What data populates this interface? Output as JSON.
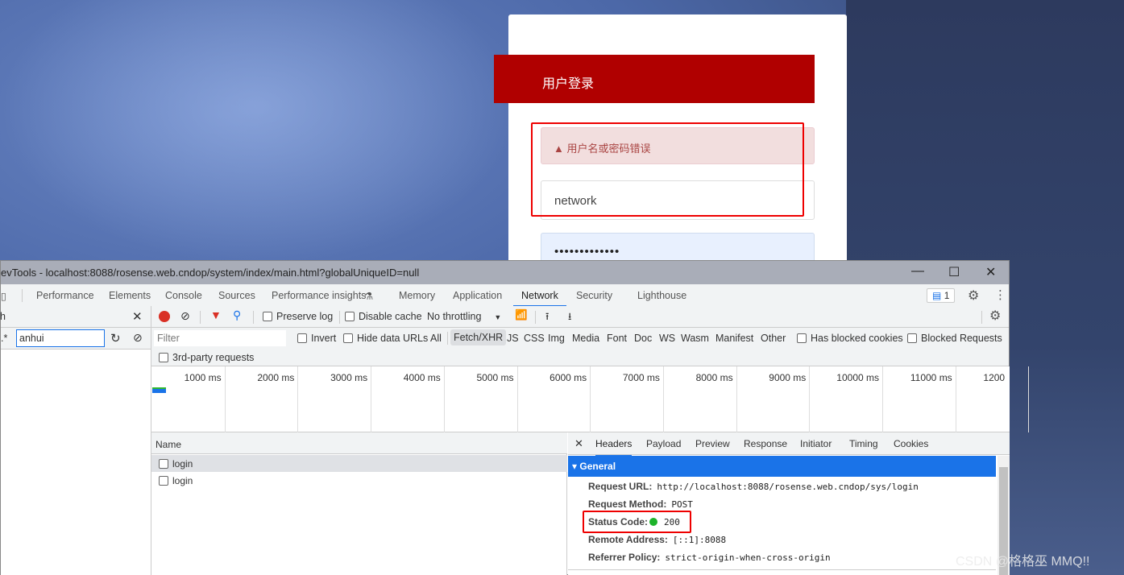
{
  "login": {
    "title": "用户登录",
    "error": "用户名或密码错误",
    "username": "network",
    "password": "•••••••••••••"
  },
  "devtools": {
    "title": "evTools - localhost:8088/rosense.web.cndop/system/index/main.html?globalUniqueID=null",
    "tabs": [
      "Performance",
      "Elements",
      "Console",
      "Sources",
      "Performance insights",
      "Memory",
      "Application",
      "Network",
      "Security",
      "Lighthouse"
    ],
    "active_tab": "Network",
    "issues_count": "1",
    "search": {
      "label": "h",
      "regex": ".*",
      "value": "anhui"
    },
    "toolbar": {
      "preserve_log": "Preserve log",
      "disable_cache": "Disable cache",
      "throttling": "No throttling"
    },
    "filter": {
      "placeholder": "Filter",
      "invert": "Invert",
      "hide_data_urls": "Hide data URLs",
      "types": [
        "All",
        "Fetch/XHR",
        "JS",
        "CSS",
        "Img",
        "Media",
        "Font",
        "Doc",
        "WS",
        "Wasm",
        "Manifest",
        "Other"
      ],
      "active_type": "Fetch/XHR",
      "has_blocked_cookies": "Has blocked cookies",
      "blocked_requests": "Blocked Requests",
      "third_party": "3rd-party requests"
    },
    "timeline": [
      "1000 ms",
      "2000 ms",
      "3000 ms",
      "4000 ms",
      "5000 ms",
      "6000 ms",
      "7000 ms",
      "8000 ms",
      "9000 ms",
      "10000 ms",
      "11000 ms",
      "1200"
    ],
    "requests": {
      "header": "Name",
      "rows": [
        "login",
        "login"
      ]
    },
    "details": {
      "tabs": [
        "Headers",
        "Payload",
        "Preview",
        "Response",
        "Initiator",
        "Timing",
        "Cookies"
      ],
      "active": "Headers",
      "section": "General",
      "fields": [
        {
          "k": "Request URL:",
          "v": "http://localhost:8088/rosense.web.cndop/sys/login"
        },
        {
          "k": "Request Method:",
          "v": "POST"
        },
        {
          "k": "Status Code:",
          "v": "200"
        },
        {
          "k": "Remote Address:",
          "v": "[::1]:8088"
        },
        {
          "k": "Referrer Policy:",
          "v": "strict-origin-when-cross-origin"
        }
      ],
      "status_color": "#1db32a"
    }
  },
  "watermark": "CSDN @格格巫 MMQ!!"
}
